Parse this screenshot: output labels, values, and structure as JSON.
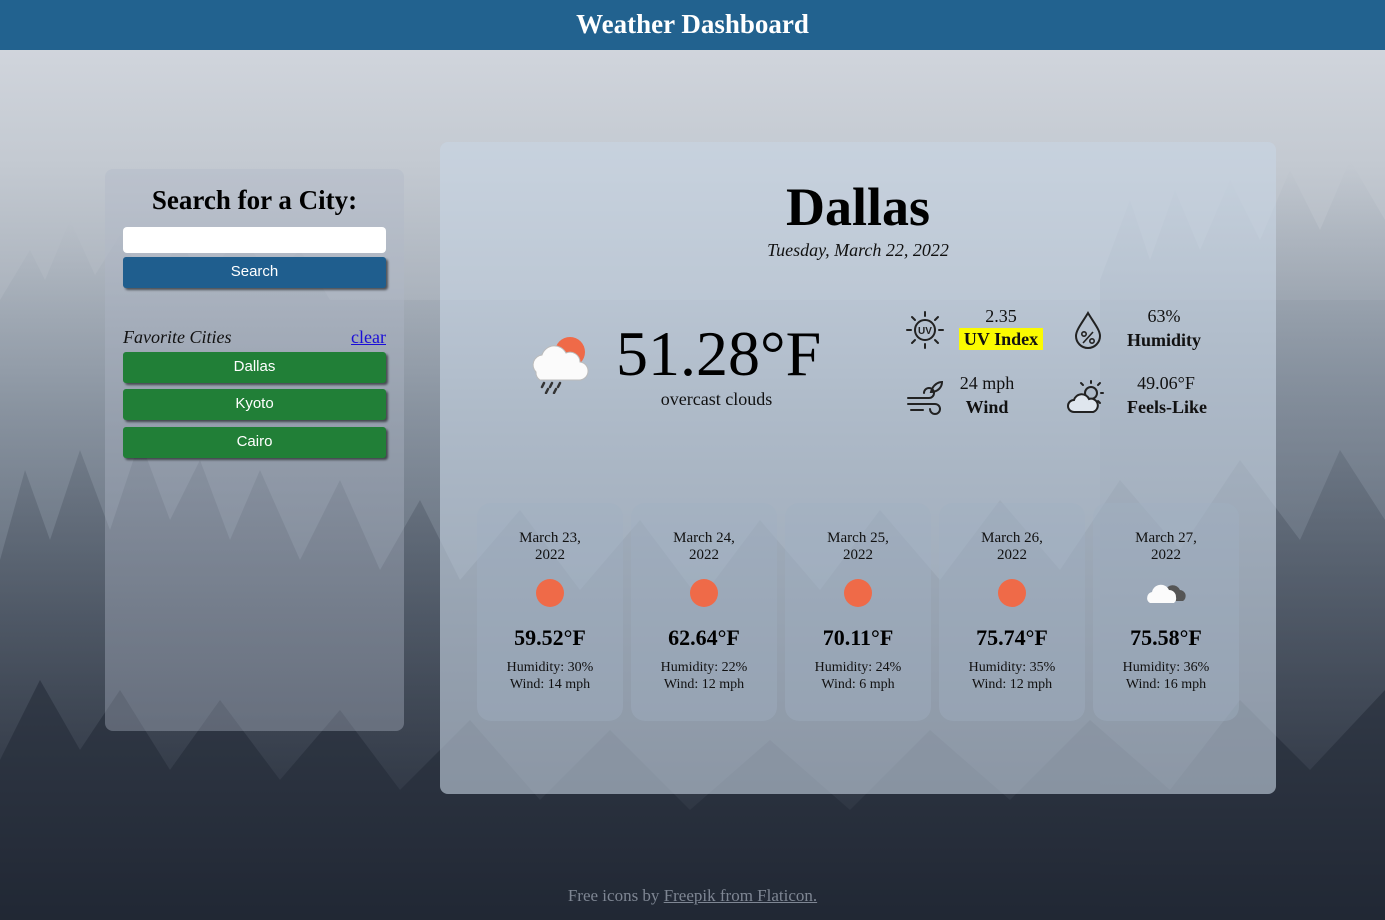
{
  "header": {
    "title": "Weather Dashboard"
  },
  "sidebar": {
    "title": "Search for a City:",
    "search_value": "",
    "search_button": "Search",
    "favorites_label": "Favorite Cities",
    "clear_label": "clear",
    "cities": [
      "Dallas",
      "Kyoto",
      "Cairo"
    ]
  },
  "current": {
    "city": "Dallas",
    "date": "Tuesday, March 22, 2022",
    "temp": "51.28°F",
    "description": "overcast clouds",
    "uv_value": "2.35",
    "uv_label": "UV Index",
    "humidity_value": "63%",
    "humidity_label": "Humidity",
    "wind_value": "24 mph",
    "wind_label": "Wind",
    "feels_value": "49.06°F",
    "feels_label": "Feels-Like",
    "icon": "rain-cloud-sun-icon"
  },
  "forecast": [
    {
      "date_line1": "March 23,",
      "date_line2": "2022",
      "icon": "sun-icon",
      "temp": "59.52°F",
      "humidity": "Humidity: 30%",
      "wind": "Wind: 14 mph"
    },
    {
      "date_line1": "March 24,",
      "date_line2": "2022",
      "icon": "sun-icon",
      "temp": "62.64°F",
      "humidity": "Humidity: 22%",
      "wind": "Wind: 12 mph"
    },
    {
      "date_line1": "March 25,",
      "date_line2": "2022",
      "icon": "sun-icon",
      "temp": "70.11°F",
      "humidity": "Humidity: 24%",
      "wind": "Wind: 6 mph"
    },
    {
      "date_line1": "March 26,",
      "date_line2": "2022",
      "icon": "sun-icon",
      "temp": "75.74°F",
      "humidity": "Humidity: 35%",
      "wind": "Wind: 12 mph"
    },
    {
      "date_line1": "March 27,",
      "date_line2": "2022",
      "icon": "cloud-icon",
      "temp": "75.58°F",
      "humidity": "Humidity: 36%",
      "wind": "Wind: 16 mph"
    }
  ],
  "footer": {
    "prefix": "Free icons by",
    "link": "Freepik from Flaticon."
  },
  "colors": {
    "header": "#22628f",
    "search_button": "#1f5e8e",
    "city_button": "#217f37",
    "uv_highlight": "#fbfb00",
    "sun": "#ef6a48"
  }
}
